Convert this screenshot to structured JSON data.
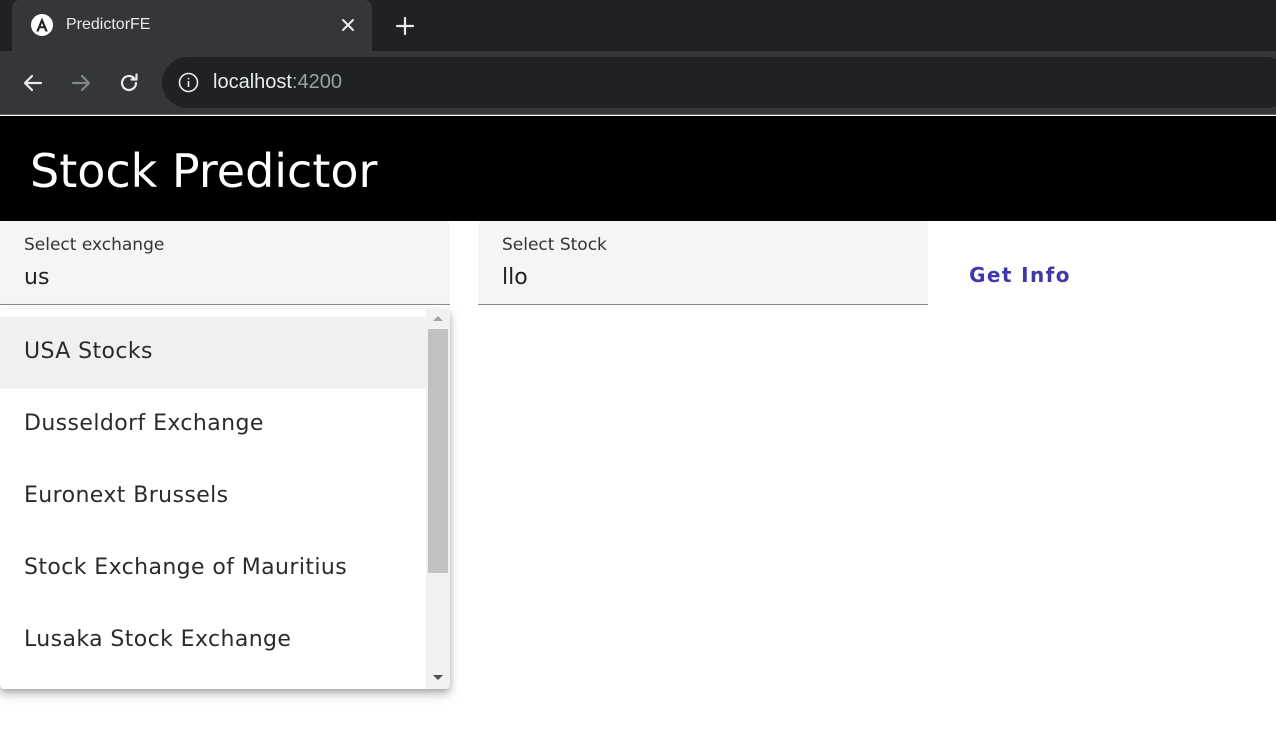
{
  "browser": {
    "tab_title": "PredictorFE",
    "url_host": "localhost",
    "url_port": ":4200"
  },
  "app": {
    "title": "Stock Predictor"
  },
  "exchange_field": {
    "label": "Select exchange",
    "value": "us"
  },
  "stock_field": {
    "label": "Select Stock",
    "value": "llo"
  },
  "get_info_button": {
    "label": "Get Info"
  },
  "autocomplete": {
    "options": [
      {
        "label": "USA Stocks"
      },
      {
        "label": "Dusseldorf Exchange"
      },
      {
        "label": "Euronext Brussels"
      },
      {
        "label": "Stock Exchange of Mauritius"
      },
      {
        "label": "Lusaka Stock Exchange"
      }
    ]
  },
  "colors": {
    "header_bg": "#000000",
    "accent": "#3f39a8",
    "field_bg": "#f5f5f5"
  }
}
